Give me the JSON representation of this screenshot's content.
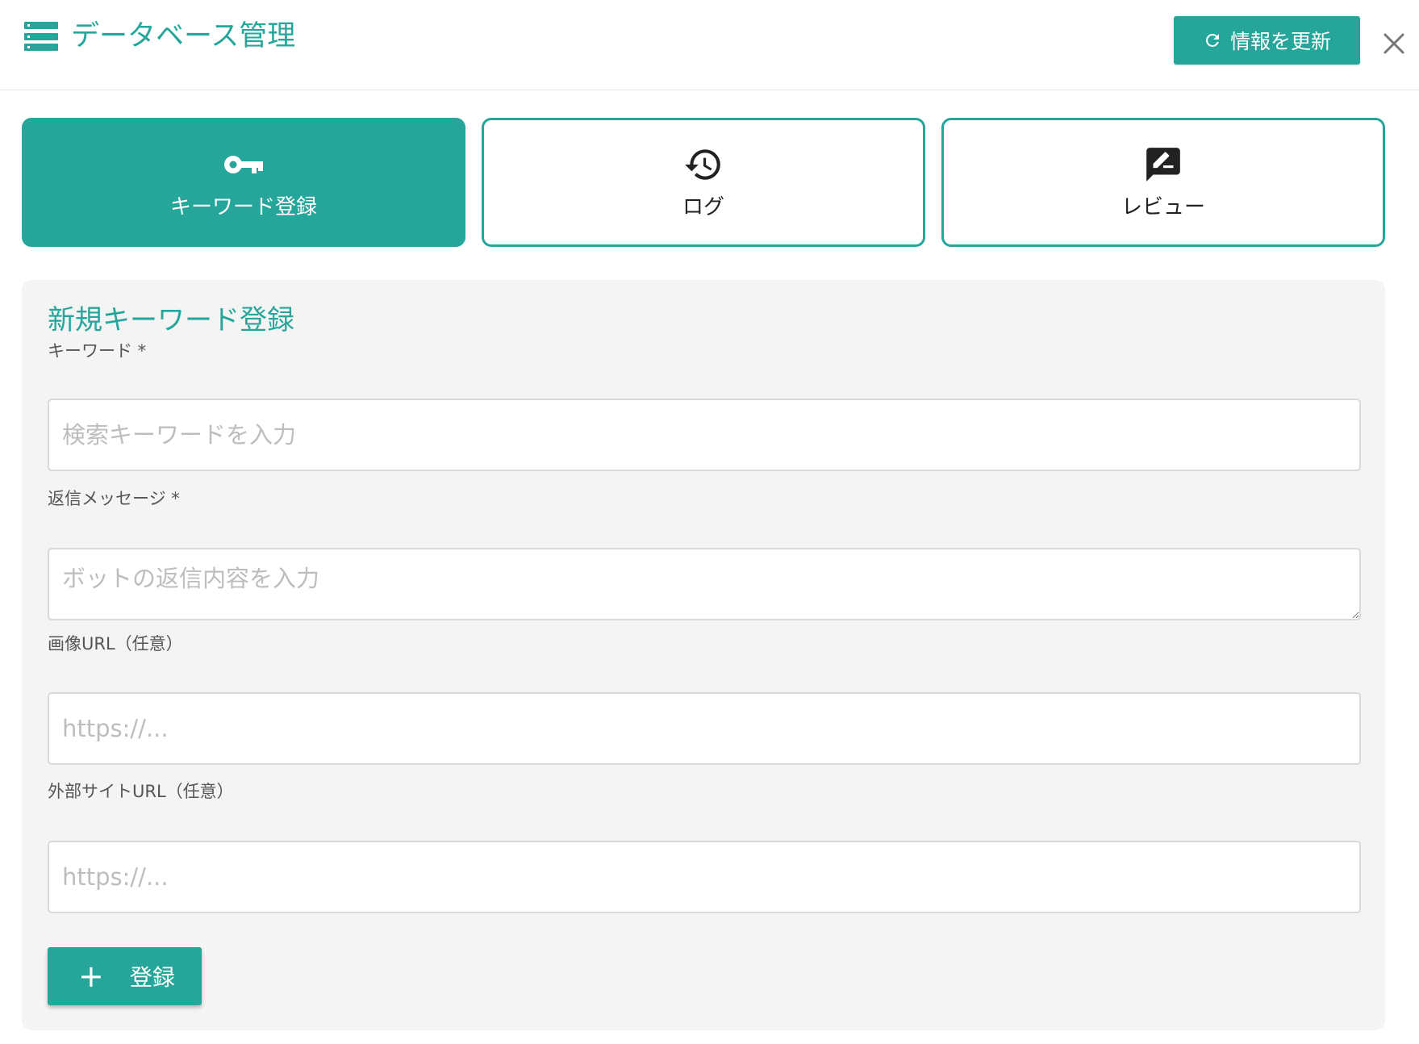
{
  "header": {
    "title": "データベース管理",
    "icon": "database-icon",
    "refresh_label": "情報を更新",
    "refresh_icon": "refresh-icon",
    "close_icon": "close-icon"
  },
  "tabs": [
    {
      "label": "キーワード登録",
      "icon": "key-icon",
      "active": true
    },
    {
      "label": "ログ",
      "icon": "history-icon",
      "active": false
    },
    {
      "label": "レビュー",
      "icon": "review-icon",
      "active": false
    }
  ],
  "form": {
    "title": "新規キーワード登録",
    "keyword": {
      "label": "キーワード *",
      "placeholder": "検索キーワードを入力",
      "value": ""
    },
    "reply": {
      "label": "返信メッセージ *",
      "placeholder": "ボットの返信内容を入力",
      "value": ""
    },
    "image_url": {
      "label": "画像URL（任意）",
      "placeholder": "https://...",
      "value": ""
    },
    "site_url": {
      "label": "外部サイトURL（任意）",
      "placeholder": "https://...",
      "value": ""
    },
    "submit_label": "登録",
    "submit_icon": "plus-icon"
  },
  "colors": {
    "accent": "#26a69a",
    "card_bg": "#f4f4f4"
  }
}
